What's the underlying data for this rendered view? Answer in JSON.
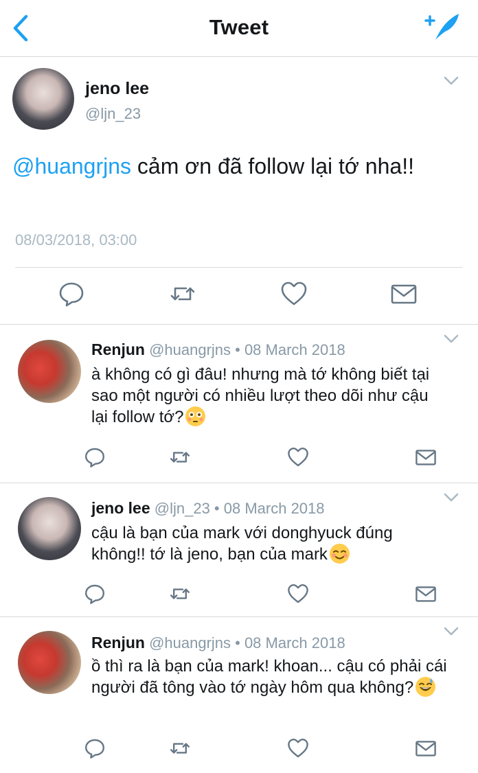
{
  "header": {
    "title": "Tweet"
  },
  "main_tweet": {
    "name": "jeno lee",
    "handle": "@ljn_23",
    "mention": "@huangrjns",
    "text": " cảm ơn đã follow lại tớ nha!!",
    "timestamp": "08/03/2018, 03:00"
  },
  "replies": [
    {
      "name": "Renjun",
      "meta": " @huangrjns • 08 March 2018",
      "text": "à không có gì đâu! nhưng mà tớ không biết tại sao một người có nhiều lượt theo dõi như cậu lại follow tớ?",
      "emoji": "flushed-face"
    },
    {
      "name": "jeno lee",
      "meta": " @ljn_23 • 08 March 2018",
      "text": "cậu là bạn của mark với donghyuck đúng không!! tớ là jeno, bạn của mark",
      "emoji": "smiling-face"
    },
    {
      "name": "Renjun",
      "meta": " @huangrjns • 08 March 2018",
      "text": "ồ thì ra là bạn của mark! khoan... cậu có phải cái người đã tông vào tớ ngày hôm qua không?",
      "emoji": "grinning-face-with-sweat"
    }
  ],
  "colors": {
    "accent": "#1da1f2",
    "muted": "#8899a6",
    "divider": "#d6d9dc"
  }
}
